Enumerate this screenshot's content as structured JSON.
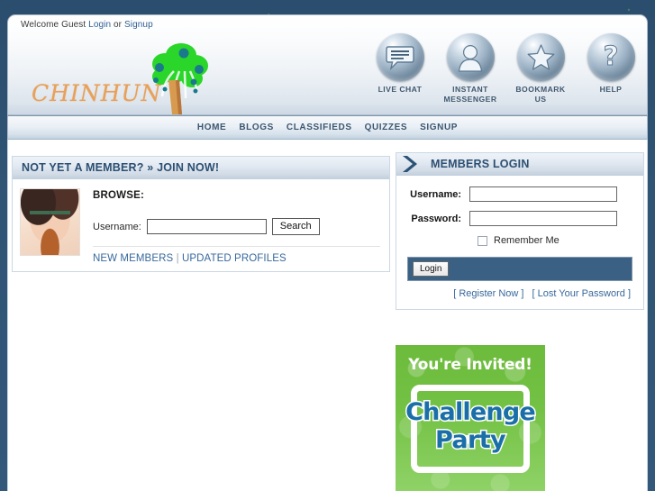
{
  "topbar": {
    "welcome_text": "Welcome Guest",
    "login_label": "Login",
    "or_text": "or",
    "signup_label": "Signup"
  },
  "brand": {
    "logo_text": "CHINHUN",
    "logo_icon": "tree-icon",
    "logo_color": "#e8a05a",
    "tree_color": "#2fd02f"
  },
  "header_icons": [
    {
      "icon": "chat-bubble-icon",
      "label": "LIVE CHAT"
    },
    {
      "icon": "person-icon",
      "label": "INSTANT MESSENGER"
    },
    {
      "icon": "star-icon",
      "label": "BOOKMARK US"
    },
    {
      "icon": "question-mark-icon",
      "label": "HELP"
    }
  ],
  "nav": {
    "items": [
      {
        "label": "HOME"
      },
      {
        "label": "BLOGS"
      },
      {
        "label": "CLASSIFIEDS"
      },
      {
        "label": "QUIZZES"
      },
      {
        "label": "SIGNUP"
      }
    ]
  },
  "join_panel": {
    "title": "NOT YET A MEMBER? » JOIN NOW!",
    "browse_label": "BROWSE:",
    "username_label": "Username:",
    "username_value": "",
    "username_placeholder": "",
    "search_button": "Search",
    "new_members_label": "NEW MEMBERS",
    "separator": "|",
    "updated_profiles_label": "UPDATED PROFILES",
    "photo_alt": "member-photo"
  },
  "login_panel": {
    "title": "MEMBERS LOGIN",
    "arrow_icon": "chevron-right-icon",
    "username_label": "Username:",
    "username_value": "",
    "password_label": "Password:",
    "password_value": "",
    "remember_label": "Remember Me",
    "remember_checked": false,
    "login_button": "Login",
    "register_link": "[ Register Now ]",
    "lost_password_link": "[ Lost Your Password ]",
    "bar_color": "#3a6183"
  },
  "promo": {
    "line1": "You're Invited!",
    "line2": "Challenge",
    "line3": "Party",
    "bg_color": "#6cbb3c",
    "text_color": "#1b6fa8"
  },
  "theme": {
    "page_bg": "#2e5272",
    "panel_border": "#cbd8e4",
    "link_color": "#38699c",
    "heading_color": "#2c4f72"
  }
}
